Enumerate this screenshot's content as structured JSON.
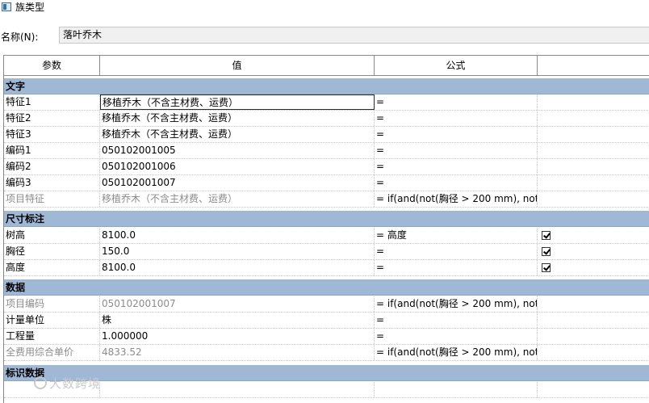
{
  "window": {
    "title": "族类型"
  },
  "name_field": {
    "label": "名称(N):",
    "value": "落叶乔木"
  },
  "columns": {
    "param": "参数",
    "value": "值",
    "formula": "公式",
    "lock": ""
  },
  "groups": {
    "text": "文字",
    "dims": "尺寸标注",
    "data": "数据",
    "identity": "标识数据"
  },
  "rows": {
    "r0": {
      "param": "特征1",
      "value": "移植乔木（不含主材费、运费）",
      "formula": "="
    },
    "r1": {
      "param": "特征2",
      "value": "移植乔木（不含主材费、运费）",
      "formula": "="
    },
    "r2": {
      "param": "特征3",
      "value": "移植乔木（不含主材费、运费）",
      "formula": "="
    },
    "r3": {
      "param": "编码1",
      "value": "050102001005",
      "formula": "="
    },
    "r4": {
      "param": "编码2",
      "value": "050102001006",
      "formula": "="
    },
    "r5": {
      "param": "编码3",
      "value": "050102001007",
      "formula": "="
    },
    "r6": {
      "param": "项目特征",
      "value": "移植乔木（不含主材费、运费）",
      "formula": "= if(and(not(胸径 > 200 mm), not("
    },
    "r7": {
      "param": "树高",
      "value": "8100.0",
      "formula": "= 高度",
      "checked": true
    },
    "r8": {
      "param": "胸径",
      "value": "150.0",
      "formula": "=",
      "checked": true
    },
    "r9": {
      "param": "高度",
      "value": "8100.0",
      "formula": "=",
      "checked": true
    },
    "r10": {
      "param": "项目编码",
      "value": "050102001007",
      "formula": "= if(and(not(胸径 > 200 mm), not("
    },
    "r11": {
      "param": "计量单位",
      "value": "株",
      "formula": "="
    },
    "r12": {
      "param": "工程量",
      "value": "1.000000",
      "formula": "="
    },
    "r13": {
      "param": "全费用综合单价",
      "value": "4833.52",
      "formula": "= if(and(not(胸径 > 200 mm), not("
    }
  },
  "watermark": "大数跨境",
  "colors": {
    "group_header": "#9fb8d6",
    "readonly_text": "#8c8c8c"
  }
}
